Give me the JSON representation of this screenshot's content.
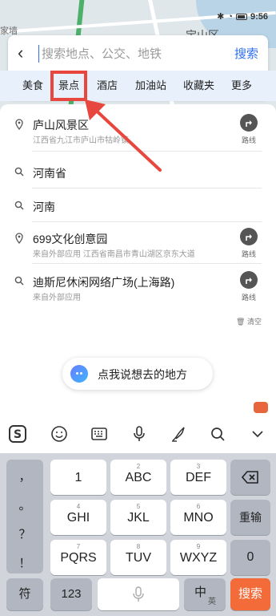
{
  "status_bar": {
    "time": "9:56"
  },
  "map": {
    "labels": [
      "宝山区",
      "家墙"
    ]
  },
  "search": {
    "placeholder": "搜索地点、公交、地铁",
    "button_label": "搜索"
  },
  "categories": [
    {
      "label": "美食",
      "selected": false
    },
    {
      "label": "景点",
      "selected": true
    },
    {
      "label": "酒店",
      "selected": false
    },
    {
      "label": "加油站",
      "selected": false
    },
    {
      "label": "收藏夹",
      "selected": false
    },
    {
      "label": "更多",
      "selected": false
    }
  ],
  "results": [
    {
      "type": "poi",
      "title": "庐山风景区",
      "subtitle": "江西省九江市庐山市牯岭镇",
      "route_label": "路线"
    },
    {
      "type": "query",
      "title": "河南省"
    },
    {
      "type": "query",
      "title": "河南"
    },
    {
      "type": "poi",
      "title": "699文化创意园",
      "subtitle": "来自外部应用  江西省南昌市青山湖区京东大道",
      "route_label": "路线"
    },
    {
      "type": "query",
      "title": "迪斯尼休闲网络广场(上海路)",
      "subtitle": "来自外部应用",
      "route_label": "路线"
    }
  ],
  "clear_label": "清空",
  "voice_prompt": "点我说想去的地方",
  "keyboard": {
    "punct": [
      "，",
      "。",
      "？",
      "！"
    ],
    "rows": [
      [
        {
          "sub": "",
          "main": "1"
        },
        {
          "sub": "2",
          "main": "ABC"
        },
        {
          "sub": "3",
          "main": "DEF"
        }
      ],
      [
        {
          "sub": "4",
          "main": "GHI"
        },
        {
          "sub": "5",
          "main": "JKL"
        },
        {
          "sub": "6",
          "main": "MNO"
        }
      ],
      [
        {
          "sub": "7",
          "main": "PQRS"
        },
        {
          "sub": "8",
          "main": "TUV"
        },
        {
          "sub": "9",
          "main": "WXYZ"
        }
      ]
    ],
    "retype_label": "重输",
    "zero_label": "0",
    "symbol_label": "符",
    "num_label": "123",
    "zh_label": "中",
    "en_label": "英",
    "enter_label": "搜索"
  }
}
